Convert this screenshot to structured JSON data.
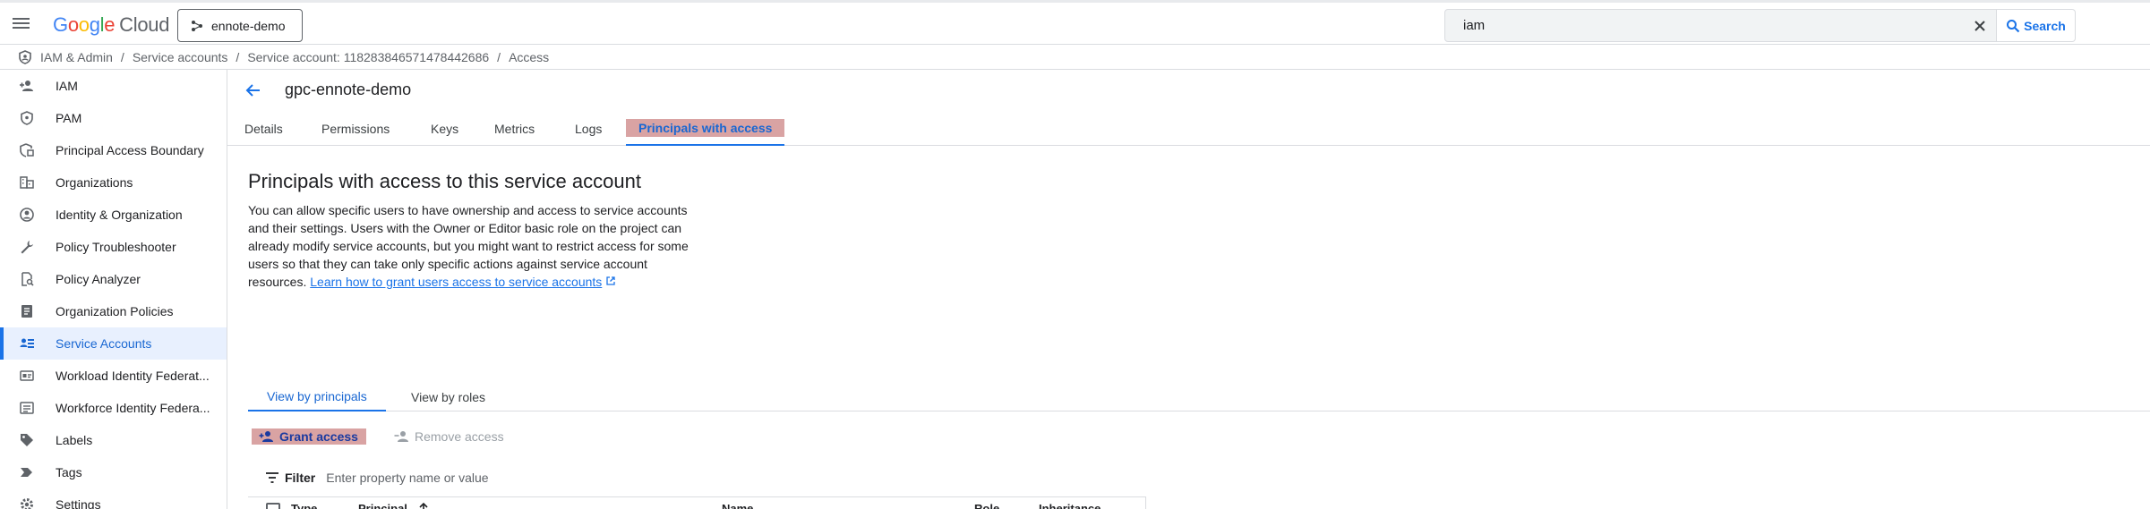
{
  "topbar": {
    "logo_google": [
      "G",
      "o",
      "o",
      "g",
      "l",
      "e"
    ],
    "logo_cloud": "Cloud",
    "project_name": "ennote-demo",
    "search_value": "iam",
    "search_button_label": "Search"
  },
  "breadcrumb": {
    "items": [
      "IAM & Admin",
      "Service accounts",
      "Service account: 118283846571478442686",
      "Access"
    ],
    "separator": "/"
  },
  "sidebar": {
    "items": [
      {
        "label": "IAM",
        "icon": "person-add-icon"
      },
      {
        "label": "PAM",
        "icon": "shield-icon"
      },
      {
        "label": "Principal Access Boundary",
        "icon": "boundary-icon"
      },
      {
        "label": "Organizations",
        "icon": "building-icon"
      },
      {
        "label": "Identity & Organization",
        "icon": "account-circle-icon"
      },
      {
        "label": "Policy Troubleshooter",
        "icon": "wrench-icon"
      },
      {
        "label": "Policy Analyzer",
        "icon": "document-search-icon"
      },
      {
        "label": "Organization Policies",
        "icon": "policy-document-icon"
      },
      {
        "label": "Service Accounts",
        "icon": "service-account-icon",
        "active": true
      },
      {
        "label": "Workload Identity Federat...",
        "icon": "id-card-icon"
      },
      {
        "label": "Workforce Identity Federa...",
        "icon": "list-card-icon"
      },
      {
        "label": "Labels",
        "icon": "tag-icon"
      },
      {
        "label": "Tags",
        "icon": "label-arrow-icon"
      },
      {
        "label": "Settings",
        "icon": "gear-icon"
      }
    ]
  },
  "main": {
    "title": "gpc-ennote-demo",
    "tabs": [
      {
        "label": "Details"
      },
      {
        "label": "Permissions"
      },
      {
        "label": "Keys"
      },
      {
        "label": "Metrics"
      },
      {
        "label": "Logs"
      },
      {
        "label": "Principals with access",
        "active": true
      }
    ],
    "section_title": "Principals with access to this service account",
    "description": "You can allow specific users to have ownership and access to service accounts and their settings. Users with the Owner or Editor basic role on the project can already modify service accounts, but you might want to restrict access for some users so that they can take only specific actions against service account resources.",
    "learn_link": "Learn how to grant users access to service accounts",
    "subtabs": [
      {
        "label": "View by principals",
        "active": true
      },
      {
        "label": "View by roles"
      }
    ],
    "grant_access_label": "Grant access",
    "remove_access_label": "Remove access",
    "filter_label": "Filter",
    "filter_placeholder": "Enter property name or value",
    "table_headers": [
      "Type",
      "Principal",
      "Name",
      "Role",
      "Inheritance"
    ]
  },
  "colors": {
    "accent": "#1a73e8",
    "highlight": "#d9a3a3",
    "active_bg": "#e8f0fe"
  }
}
